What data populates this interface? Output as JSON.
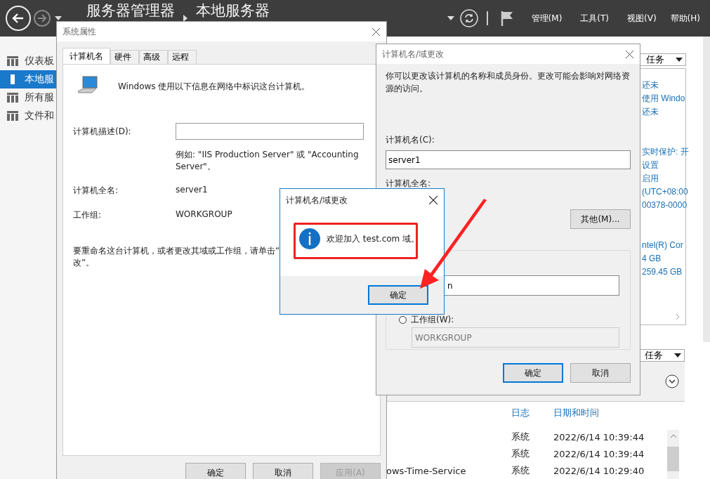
{
  "server_manager": {
    "breadcrumb": [
      "服务器管理器",
      "本地服务器"
    ],
    "menu": [
      "管理(M)",
      "工具(T)",
      "视图(V)",
      "帮助(H)"
    ],
    "sidebar": {
      "items": [
        {
          "label": "仪表板",
          "selected": false
        },
        {
          "label": "本地服",
          "selected": true
        },
        {
          "label": "所有服",
          "selected": false
        },
        {
          "label": "文件和",
          "selected": false
        }
      ]
    },
    "properties_panel": {
      "tasks_label": "任务",
      "groups": [
        [
          "还未",
          "使用 Windo",
          "还未"
        ],
        [
          "实时保护: 开",
          "设置",
          "启用",
          "(UTC+08:00",
          "00378-0000"
        ],
        [
          "ntel(R) Cor",
          "4 GB",
          "259.45 GB"
        ]
      ]
    },
    "events_panel": {
      "tasks_label": "任务",
      "columns": [
        "日志",
        "日期和时间"
      ],
      "rows": [
        {
          "log": "系统",
          "time": "2022/6/14 10:39:44"
        },
        {
          "log": "系统",
          "time": "2022/6/14 10:39:44"
        },
        {
          "source": "ows-Time-Service",
          "log": "系统",
          "time": "2022/6/14 10:29:40"
        }
      ]
    }
  },
  "system_properties": {
    "title": "系统属性",
    "tabs": [
      {
        "label": "计算机名",
        "selected": true
      },
      {
        "label": "硬件",
        "selected": false
      },
      {
        "label": "高级",
        "selected": false
      },
      {
        "label": "远程",
        "selected": false
      }
    ],
    "intro": "Windows 使用以下信息在网络中标识这台计算机。",
    "description_label": "计算机描述(D):",
    "example": "例如: \"IIS Production Server\" 或 \"Accounting Server\"。",
    "full_name_label": "计算机全名:",
    "full_name": "server1",
    "workgroup_label": "工作组:",
    "workgroup": "WORKGROUP",
    "rename_hint_lines": [
      "要重命名这台计算机，或者更改其域或工作组，请单击“",
      "改”。"
    ],
    "buttons": [
      {
        "label": "确定",
        "disabled": false
      },
      {
        "label": "取消",
        "disabled": false
      },
      {
        "label": "应用(A)",
        "disabled": true
      }
    ]
  },
  "name_change": {
    "title": "计算机名/域更改",
    "description": "你可以更改该计算机的名称和成员身份。更改可能会影响对网络资源的访问。",
    "name_label": "计算机名(C):",
    "name_value": "server1",
    "full_name_label": "计算机全名:",
    "more_button": "其他(M)...",
    "domain_value": "n",
    "workgroup_radio": {
      "label": "工作组(W):",
      "selected": false
    },
    "workgroup_value": "WORKGROUP",
    "buttons": [
      {
        "label": "确定",
        "default": true
      },
      {
        "label": "取消",
        "default": false
      }
    ]
  },
  "message_box": {
    "title": "计算机名/域更改",
    "message": "欢迎加入 test.com 域。",
    "button": {
      "label": "确定",
      "default": true
    }
  }
}
